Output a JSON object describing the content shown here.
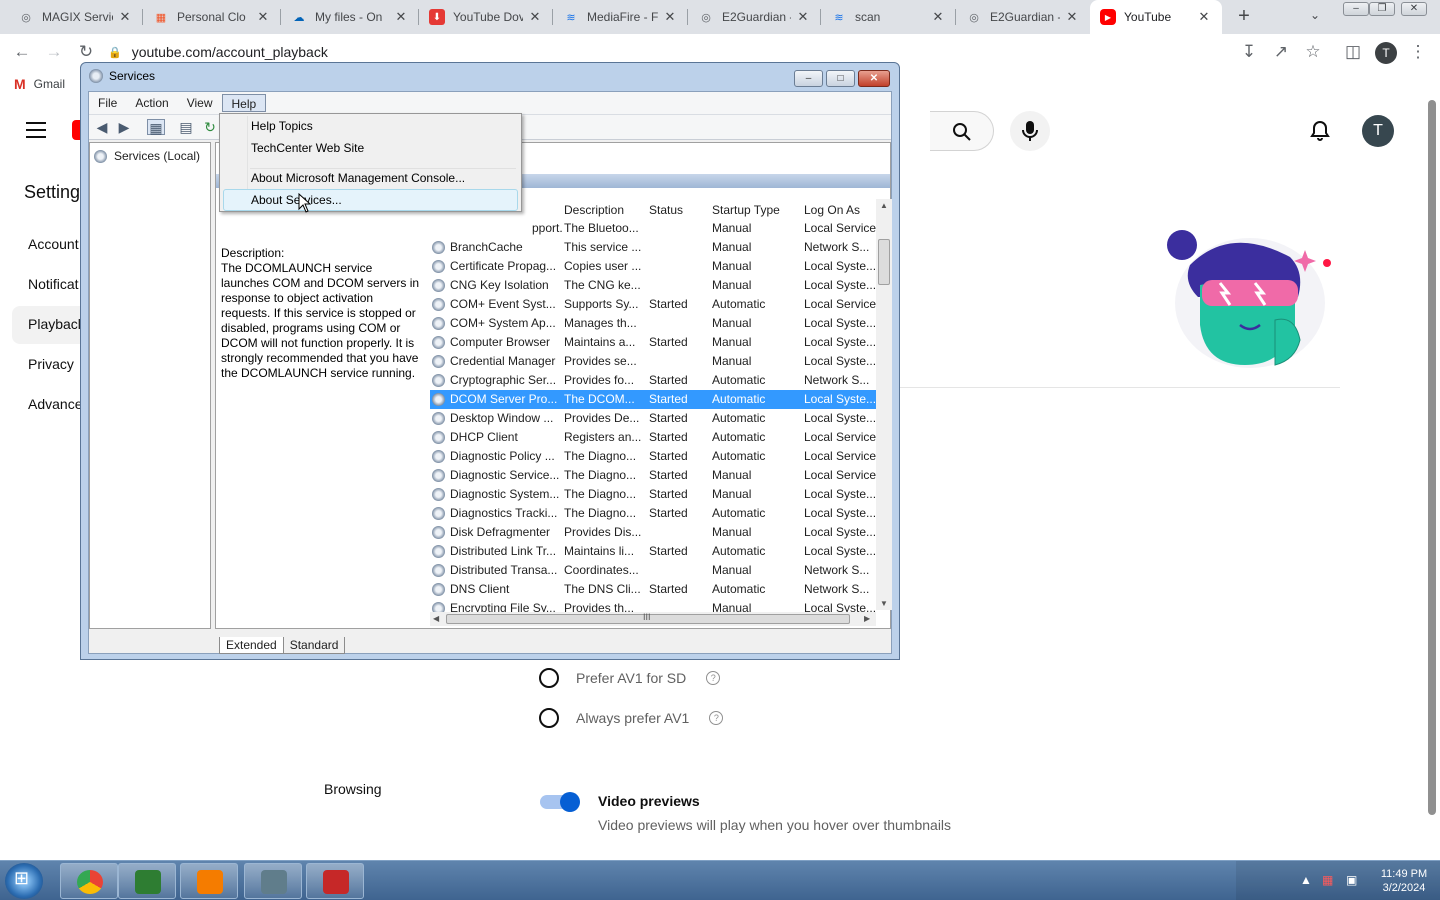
{
  "browser": {
    "tabs": [
      {
        "title": "MAGIX Servic",
        "icon": "globe-icon",
        "color": "#5f6368"
      },
      {
        "title": "Personal Clo",
        "icon": "microsoft-icon",
        "color": "#f25022"
      },
      {
        "title": "My files - On",
        "icon": "onedrive-icon",
        "color": "#0364b8"
      },
      {
        "title": "YouTube Dov",
        "icon": "download-icon",
        "color": "#e53935"
      },
      {
        "title": "MediaFire - F",
        "icon": "mediafire-icon",
        "color": "#1a73e8"
      },
      {
        "title": "E2Guardian -",
        "icon": "globe-icon",
        "color": "#5f6368"
      },
      {
        "title": "scan",
        "icon": "mediafire-icon",
        "color": "#1a73e8"
      },
      {
        "title": "E2Guardian -",
        "icon": "globe-icon",
        "color": "#5f6368"
      },
      {
        "title": "YouTube",
        "icon": "youtube-icon",
        "color": "#ff0000"
      }
    ],
    "new_tab_label": "+",
    "url": "youtube.com/account_playback",
    "profile_initial": "T",
    "bookmark": "Gmail"
  },
  "youtube": {
    "avatar_initial": "T",
    "settings_title": "Setting",
    "nav": [
      "Account",
      "Notificat",
      "Playbacl",
      "Privacy",
      "Advance"
    ],
    "options": [
      {
        "label": "Prefer AV1 for SD"
      },
      {
        "label": "Always prefer AV1"
      }
    ],
    "browsing_label": "Browsing",
    "video_previews": {
      "title": "Video previews",
      "description": "Video previews will play when you hover over thumbnails",
      "enabled": true
    }
  },
  "services": {
    "window_title": "Services",
    "menu": [
      "File",
      "Action",
      "View",
      "Help"
    ],
    "tree_item": "Services (Local)",
    "help_menu": [
      "Help Topics",
      "TechCenter Web Site",
      "About Microsoft Management Console...",
      "About Services..."
    ],
    "description_label": "Description:",
    "description": "The DCOMLAUNCH service launches COM and DCOM servers in response to object activation requests. If this service is stopped or disabled, programs using COM or DCOM will not function properly. It is strongly recommended that you have the DCOMLAUNCH service running.",
    "columns": [
      "Description",
      "Status",
      "Startup Type",
      "Log On As"
    ],
    "rows": [
      {
        "name": "",
        "description": "The Bluetoo...",
        "status": "",
        "startup": "Manual",
        "logon": "Local Service",
        "name_tail": "pport..."
      },
      {
        "name": "BranchCache",
        "description": "This service ...",
        "status": "",
        "startup": "Manual",
        "logon": "Network S..."
      },
      {
        "name": "Certificate Propag...",
        "description": "Copies user ...",
        "status": "",
        "startup": "Manual",
        "logon": "Local Syste..."
      },
      {
        "name": "CNG Key Isolation",
        "description": "The CNG ke...",
        "status": "",
        "startup": "Manual",
        "logon": "Local Syste..."
      },
      {
        "name": "COM+ Event Syst...",
        "description": "Supports Sy...",
        "status": "Started",
        "startup": "Automatic",
        "logon": "Local Service"
      },
      {
        "name": "COM+ System Ap...",
        "description": "Manages th...",
        "status": "",
        "startup": "Manual",
        "logon": "Local Syste..."
      },
      {
        "name": "Computer Browser",
        "description": "Maintains a...",
        "status": "Started",
        "startup": "Manual",
        "logon": "Local Syste..."
      },
      {
        "name": "Credential Manager",
        "description": "Provides se...",
        "status": "",
        "startup": "Manual",
        "logon": "Local Syste..."
      },
      {
        "name": "Cryptographic Ser...",
        "description": "Provides fo...",
        "status": "Started",
        "startup": "Automatic",
        "logon": "Network S..."
      },
      {
        "name": "DCOM Server Pro...",
        "description": "The DCOM...",
        "status": "Started",
        "startup": "Automatic",
        "logon": "Local Syste...",
        "selected": true
      },
      {
        "name": "Desktop Window ...",
        "description": "Provides De...",
        "status": "Started",
        "startup": "Automatic",
        "logon": "Local Syste..."
      },
      {
        "name": "DHCP Client",
        "description": "Registers an...",
        "status": "Started",
        "startup": "Automatic",
        "logon": "Local Service"
      },
      {
        "name": "Diagnostic Policy ...",
        "description": "The Diagno...",
        "status": "Started",
        "startup": "Automatic",
        "logon": "Local Service"
      },
      {
        "name": "Diagnostic Service...",
        "description": "The Diagno...",
        "status": "Started",
        "startup": "Manual",
        "logon": "Local Service"
      },
      {
        "name": "Diagnostic System...",
        "description": "The Diagno...",
        "status": "Started",
        "startup": "Manual",
        "logon": "Local Syste..."
      },
      {
        "name": "Diagnostics Tracki...",
        "description": "The Diagno...",
        "status": "Started",
        "startup": "Automatic",
        "logon": "Local Syste..."
      },
      {
        "name": "Disk Defragmenter",
        "description": "Provides Dis...",
        "status": "",
        "startup": "Manual",
        "logon": "Local Syste..."
      },
      {
        "name": "Distributed Link Tr...",
        "description": "Maintains li...",
        "status": "Started",
        "startup": "Automatic",
        "logon": "Local Syste..."
      },
      {
        "name": "Distributed Transa...",
        "description": "Coordinates...",
        "status": "",
        "startup": "Manual",
        "logon": "Network S..."
      },
      {
        "name": "DNS Client",
        "description": "The DNS Cli...",
        "status": "Started",
        "startup": "Automatic",
        "logon": "Network S..."
      },
      {
        "name": "Encrypting File Sy...",
        "description": "Provides th...",
        "status": "",
        "startup": "Manual",
        "logon": "Local Syste..."
      }
    ],
    "tabs": [
      "Extended",
      "Standard"
    ],
    "hscroll_grip": "III"
  },
  "taskbar": {
    "apps": [
      {
        "name": "chrome-app",
        "color": "#4285f4"
      },
      {
        "name": "video-editor-app",
        "color": "#2e7d32"
      },
      {
        "name": "media-player-app",
        "color": "#f57c00"
      },
      {
        "name": "computer-management-app",
        "color": "#607d8b"
      },
      {
        "name": "toolbox-app",
        "color": "#c62828"
      }
    ],
    "time": "11:49 PM",
    "date": "3/2/2024"
  }
}
